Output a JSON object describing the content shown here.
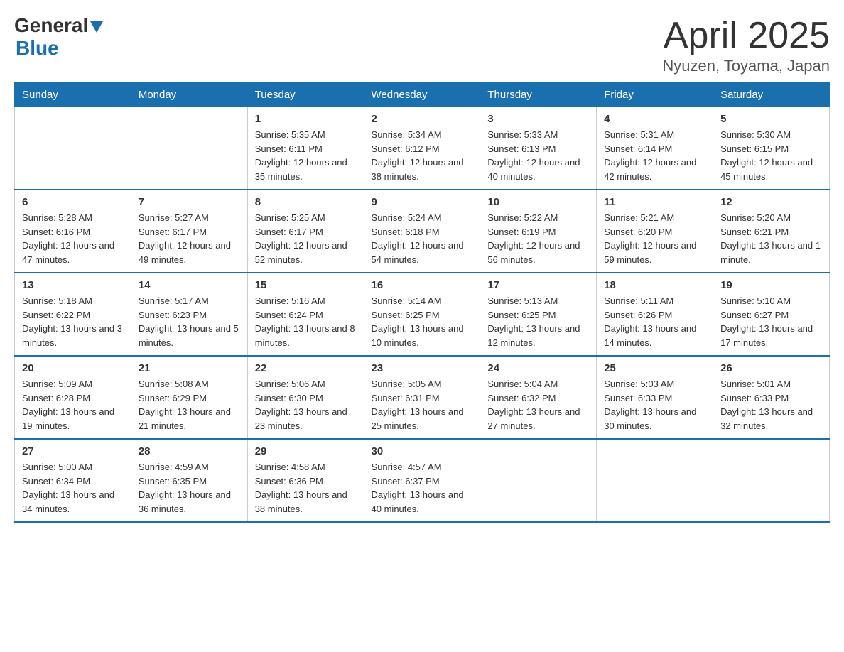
{
  "header": {
    "logo_general": "General",
    "logo_blue": "Blue",
    "title": "April 2025",
    "subtitle": "Nyuzen, Toyama, Japan"
  },
  "calendar": {
    "days_of_week": [
      "Sunday",
      "Monday",
      "Tuesday",
      "Wednesday",
      "Thursday",
      "Friday",
      "Saturday"
    ],
    "weeks": [
      [
        {
          "day": "",
          "sunrise": "",
          "sunset": "",
          "daylight": ""
        },
        {
          "day": "",
          "sunrise": "",
          "sunset": "",
          "daylight": ""
        },
        {
          "day": "1",
          "sunrise": "Sunrise: 5:35 AM",
          "sunset": "Sunset: 6:11 PM",
          "daylight": "Daylight: 12 hours and 35 minutes."
        },
        {
          "day": "2",
          "sunrise": "Sunrise: 5:34 AM",
          "sunset": "Sunset: 6:12 PM",
          "daylight": "Daylight: 12 hours and 38 minutes."
        },
        {
          "day": "3",
          "sunrise": "Sunrise: 5:33 AM",
          "sunset": "Sunset: 6:13 PM",
          "daylight": "Daylight: 12 hours and 40 minutes."
        },
        {
          "day": "4",
          "sunrise": "Sunrise: 5:31 AM",
          "sunset": "Sunset: 6:14 PM",
          "daylight": "Daylight: 12 hours and 42 minutes."
        },
        {
          "day": "5",
          "sunrise": "Sunrise: 5:30 AM",
          "sunset": "Sunset: 6:15 PM",
          "daylight": "Daylight: 12 hours and 45 minutes."
        }
      ],
      [
        {
          "day": "6",
          "sunrise": "Sunrise: 5:28 AM",
          "sunset": "Sunset: 6:16 PM",
          "daylight": "Daylight: 12 hours and 47 minutes."
        },
        {
          "day": "7",
          "sunrise": "Sunrise: 5:27 AM",
          "sunset": "Sunset: 6:17 PM",
          "daylight": "Daylight: 12 hours and 49 minutes."
        },
        {
          "day": "8",
          "sunrise": "Sunrise: 5:25 AM",
          "sunset": "Sunset: 6:17 PM",
          "daylight": "Daylight: 12 hours and 52 minutes."
        },
        {
          "day": "9",
          "sunrise": "Sunrise: 5:24 AM",
          "sunset": "Sunset: 6:18 PM",
          "daylight": "Daylight: 12 hours and 54 minutes."
        },
        {
          "day": "10",
          "sunrise": "Sunrise: 5:22 AM",
          "sunset": "Sunset: 6:19 PM",
          "daylight": "Daylight: 12 hours and 56 minutes."
        },
        {
          "day": "11",
          "sunrise": "Sunrise: 5:21 AM",
          "sunset": "Sunset: 6:20 PM",
          "daylight": "Daylight: 12 hours and 59 minutes."
        },
        {
          "day": "12",
          "sunrise": "Sunrise: 5:20 AM",
          "sunset": "Sunset: 6:21 PM",
          "daylight": "Daylight: 13 hours and 1 minute."
        }
      ],
      [
        {
          "day": "13",
          "sunrise": "Sunrise: 5:18 AM",
          "sunset": "Sunset: 6:22 PM",
          "daylight": "Daylight: 13 hours and 3 minutes."
        },
        {
          "day": "14",
          "sunrise": "Sunrise: 5:17 AM",
          "sunset": "Sunset: 6:23 PM",
          "daylight": "Daylight: 13 hours and 5 minutes."
        },
        {
          "day": "15",
          "sunrise": "Sunrise: 5:16 AM",
          "sunset": "Sunset: 6:24 PM",
          "daylight": "Daylight: 13 hours and 8 minutes."
        },
        {
          "day": "16",
          "sunrise": "Sunrise: 5:14 AM",
          "sunset": "Sunset: 6:25 PM",
          "daylight": "Daylight: 13 hours and 10 minutes."
        },
        {
          "day": "17",
          "sunrise": "Sunrise: 5:13 AM",
          "sunset": "Sunset: 6:25 PM",
          "daylight": "Daylight: 13 hours and 12 minutes."
        },
        {
          "day": "18",
          "sunrise": "Sunrise: 5:11 AM",
          "sunset": "Sunset: 6:26 PM",
          "daylight": "Daylight: 13 hours and 14 minutes."
        },
        {
          "day": "19",
          "sunrise": "Sunrise: 5:10 AM",
          "sunset": "Sunset: 6:27 PM",
          "daylight": "Daylight: 13 hours and 17 minutes."
        }
      ],
      [
        {
          "day": "20",
          "sunrise": "Sunrise: 5:09 AM",
          "sunset": "Sunset: 6:28 PM",
          "daylight": "Daylight: 13 hours and 19 minutes."
        },
        {
          "day": "21",
          "sunrise": "Sunrise: 5:08 AM",
          "sunset": "Sunset: 6:29 PM",
          "daylight": "Daylight: 13 hours and 21 minutes."
        },
        {
          "day": "22",
          "sunrise": "Sunrise: 5:06 AM",
          "sunset": "Sunset: 6:30 PM",
          "daylight": "Daylight: 13 hours and 23 minutes."
        },
        {
          "day": "23",
          "sunrise": "Sunrise: 5:05 AM",
          "sunset": "Sunset: 6:31 PM",
          "daylight": "Daylight: 13 hours and 25 minutes."
        },
        {
          "day": "24",
          "sunrise": "Sunrise: 5:04 AM",
          "sunset": "Sunset: 6:32 PM",
          "daylight": "Daylight: 13 hours and 27 minutes."
        },
        {
          "day": "25",
          "sunrise": "Sunrise: 5:03 AM",
          "sunset": "Sunset: 6:33 PM",
          "daylight": "Daylight: 13 hours and 30 minutes."
        },
        {
          "day": "26",
          "sunrise": "Sunrise: 5:01 AM",
          "sunset": "Sunset: 6:33 PM",
          "daylight": "Daylight: 13 hours and 32 minutes."
        }
      ],
      [
        {
          "day": "27",
          "sunrise": "Sunrise: 5:00 AM",
          "sunset": "Sunset: 6:34 PM",
          "daylight": "Daylight: 13 hours and 34 minutes."
        },
        {
          "day": "28",
          "sunrise": "Sunrise: 4:59 AM",
          "sunset": "Sunset: 6:35 PM",
          "daylight": "Daylight: 13 hours and 36 minutes."
        },
        {
          "day": "29",
          "sunrise": "Sunrise: 4:58 AM",
          "sunset": "Sunset: 6:36 PM",
          "daylight": "Daylight: 13 hours and 38 minutes."
        },
        {
          "day": "30",
          "sunrise": "Sunrise: 4:57 AM",
          "sunset": "Sunset: 6:37 PM",
          "daylight": "Daylight: 13 hours and 40 minutes."
        },
        {
          "day": "",
          "sunrise": "",
          "sunset": "",
          "daylight": ""
        },
        {
          "day": "",
          "sunrise": "",
          "sunset": "",
          "daylight": ""
        },
        {
          "day": "",
          "sunrise": "",
          "sunset": "",
          "daylight": ""
        }
      ]
    ]
  }
}
